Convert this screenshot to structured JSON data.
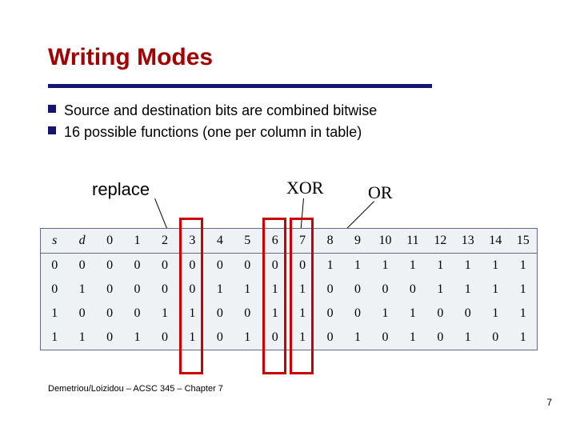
{
  "title": "Writing Modes",
  "bullets": [
    "Source and destination bits are combined bitwise",
    "16 possible functions (one per column in table)"
  ],
  "labels": {
    "replace": "replace",
    "xor": "XOR",
    "or": "OR"
  },
  "chart_data": {
    "type": "table",
    "title": "Writing Modes truth table",
    "header": [
      "s",
      "d",
      "0",
      "1",
      "2",
      "3",
      "4",
      "5",
      "6",
      "7",
      "8",
      "9",
      "10",
      "11",
      "12",
      "13",
      "14",
      "15"
    ],
    "rows": [
      [
        "0",
        "0",
        "0",
        "0",
        "0",
        "0",
        "0",
        "0",
        "0",
        "0",
        "1",
        "1",
        "1",
        "1",
        "1",
        "1",
        "1",
        "1"
      ],
      [
        "0",
        "1",
        "0",
        "0",
        "0",
        "0",
        "1",
        "1",
        "1",
        "1",
        "0",
        "0",
        "0",
        "0",
        "1",
        "1",
        "1",
        "1"
      ],
      [
        "1",
        "0",
        "0",
        "0",
        "1",
        "1",
        "0",
        "0",
        "1",
        "1",
        "0",
        "0",
        "1",
        "1",
        "0",
        "0",
        "1",
        "1"
      ],
      [
        "1",
        "1",
        "0",
        "1",
        "0",
        "1",
        "0",
        "1",
        "0",
        "1",
        "0",
        "1",
        "0",
        "1",
        "0",
        "1",
        "0",
        "1"
      ]
    ],
    "highlighted_columns": [
      {
        "index": 3,
        "label": "replace"
      },
      {
        "index": 6,
        "label": "XOR"
      },
      {
        "index": 7,
        "label": "OR"
      }
    ]
  },
  "footer": "Demetriou/Loizidou – ACSC 345 – Chapter 7",
  "page_number": "7"
}
